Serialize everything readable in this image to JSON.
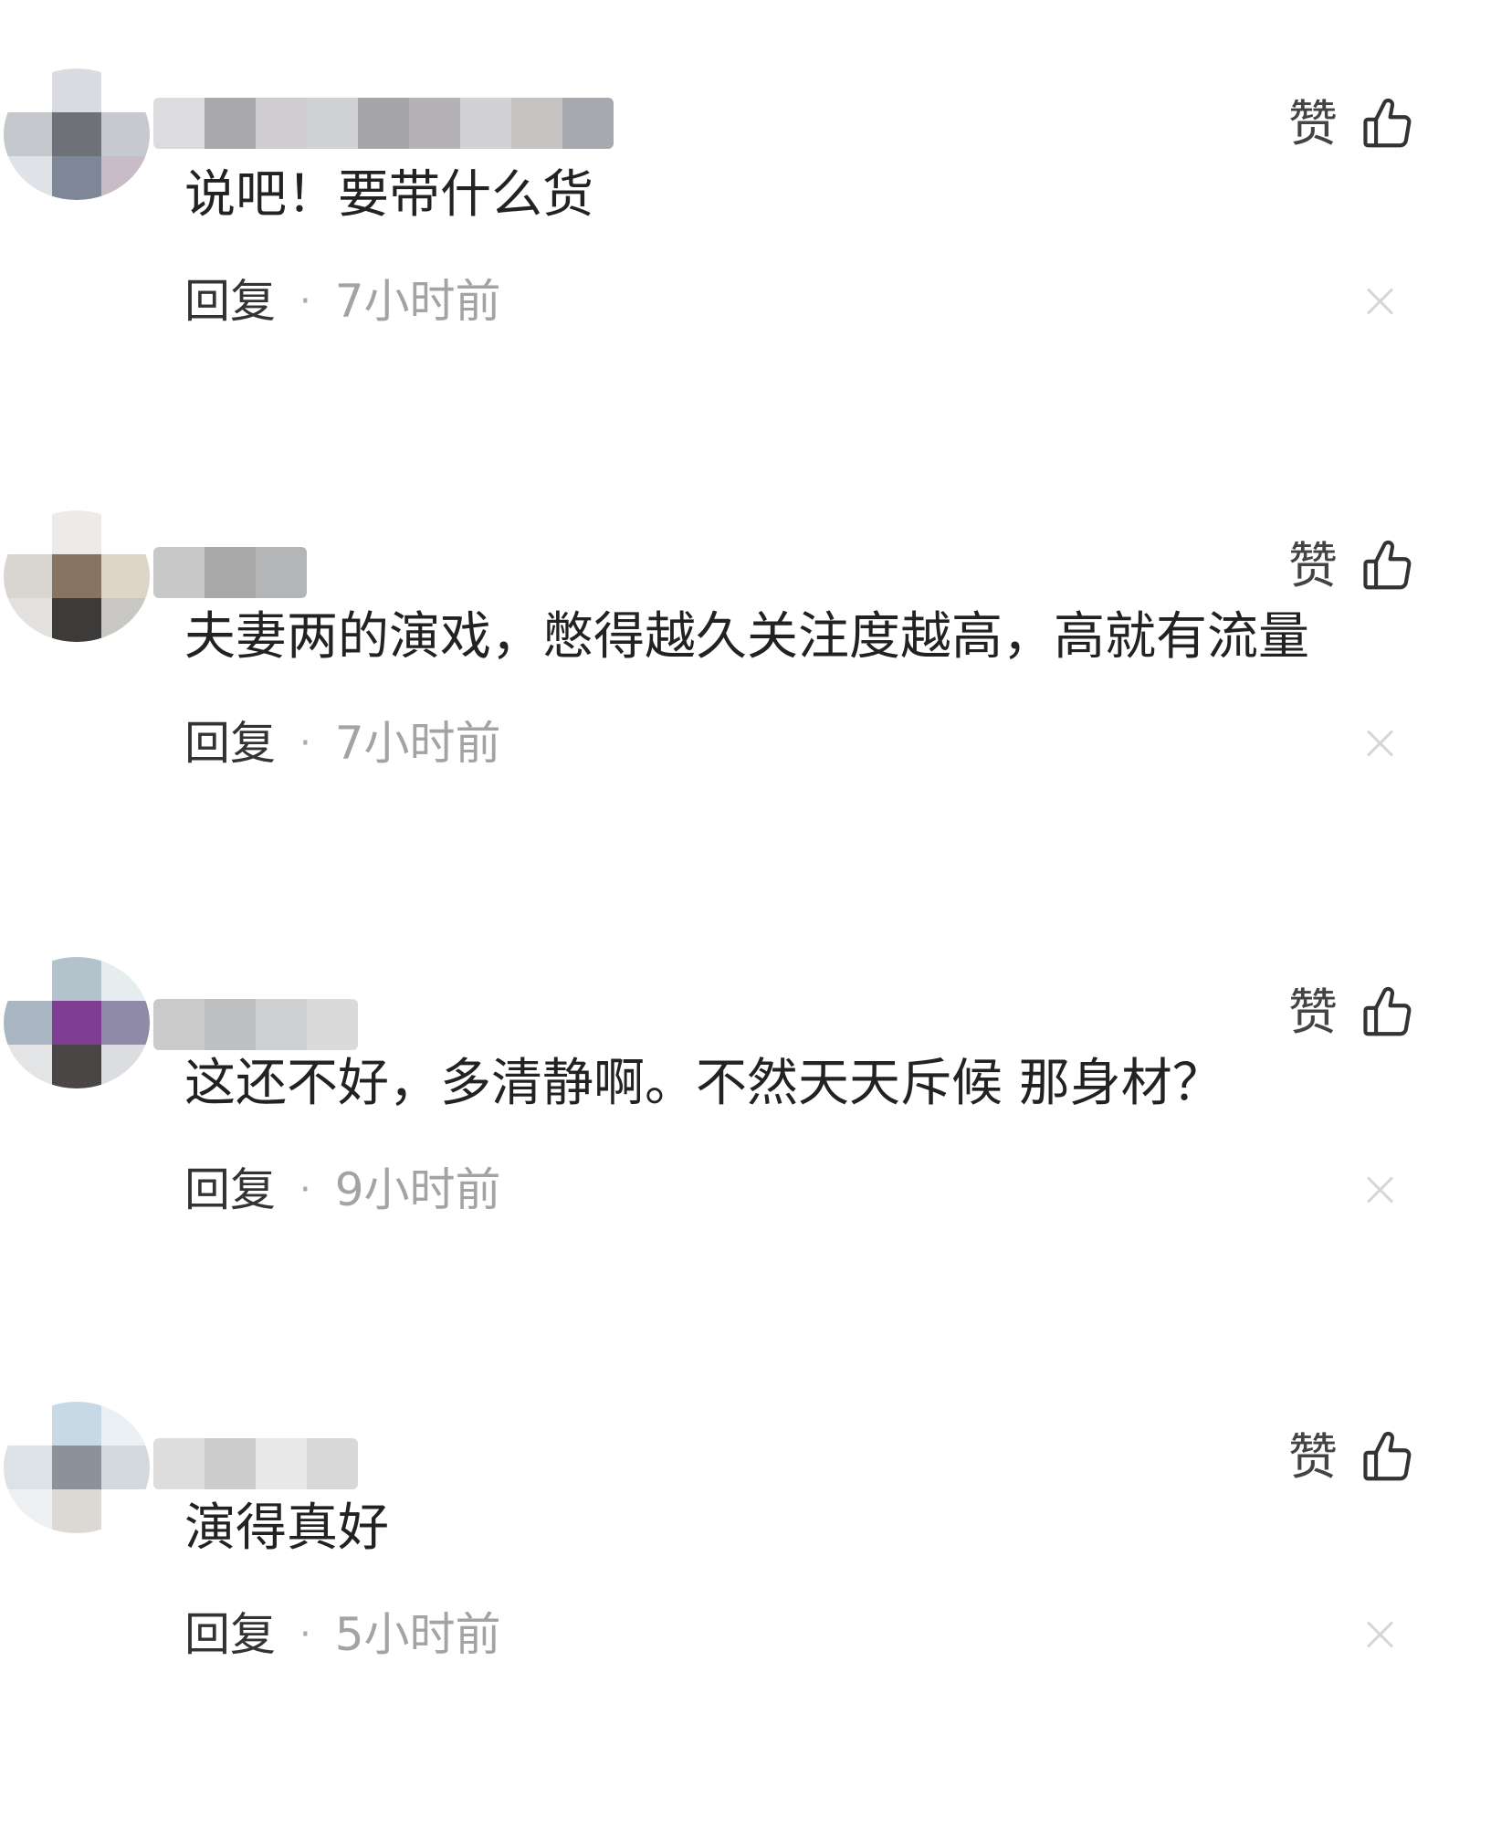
{
  "like_label": "赞",
  "reply_label": "回复",
  "separator": "·",
  "icons": {
    "like": "thumbs-up-icon",
    "dismiss": "close-icon"
  },
  "comments": [
    {
      "text": "说吧！要带什么货",
      "time": "7小时前",
      "avatar_colors": [
        "#ffffff",
        "#d8dbdf",
        "#ffffff",
        "#c4c7cc",
        "#6e7177",
        "#c6c9cf",
        "#dfe2e6",
        "#7d8797",
        "#c8bcc6"
      ],
      "name_colors": [
        "#dcdcdf",
        "#a9a8ab",
        "#d0cdd1",
        "#cfd1d4",
        "#a6a6a8",
        "#b5b2b6",
        "#d2d2d4",
        "#c6c3c2",
        "#a6a9ad"
      ]
    },
    {
      "text": "夫妻两的演戏，憋得越久关注度越高，高就有流量",
      "time": "7小时前",
      "avatar_colors": [
        "#ffffff",
        "#ecebe8",
        "#ffffff",
        "#d9d6d2",
        "#877461",
        "#dcd5c8",
        "#e3e1de",
        "#3c3b39",
        "#c9c7c3"
      ],
      "name_colors": [
        "#c8c8c8",
        "#a8a8a8",
        "#b4b5b6"
      ]
    },
    {
      "text": "这还不好，多清静啊。不然天天斥候 那身材？",
      "time": "9小时前",
      "avatar_colors": [
        "#ffffff",
        "#b3c3cc",
        "#e7ecef",
        "#aab6c2",
        "#7f3c91",
        "#8f8aa8",
        "#e3e4e6",
        "#4a4646",
        "#dcdde0"
      ],
      "name_colors": [
        "#cacaca",
        "#bfc0c1",
        "#cfd0d2",
        "#dadada"
      ]
    },
    {
      "text": "演得真好",
      "time": "5小时前",
      "avatar_colors": [
        "#ffffff",
        "#c8d9e6",
        "#eaf0f4",
        "#dde2e6",
        "#8c9299",
        "#d4d9dd",
        "#eef0f1",
        "#dcd8d3",
        "#ffffff"
      ],
      "name_colors": [
        "#dddddd",
        "#cccccc",
        "#e8e8e8",
        "#d8d8d8"
      ]
    }
  ]
}
